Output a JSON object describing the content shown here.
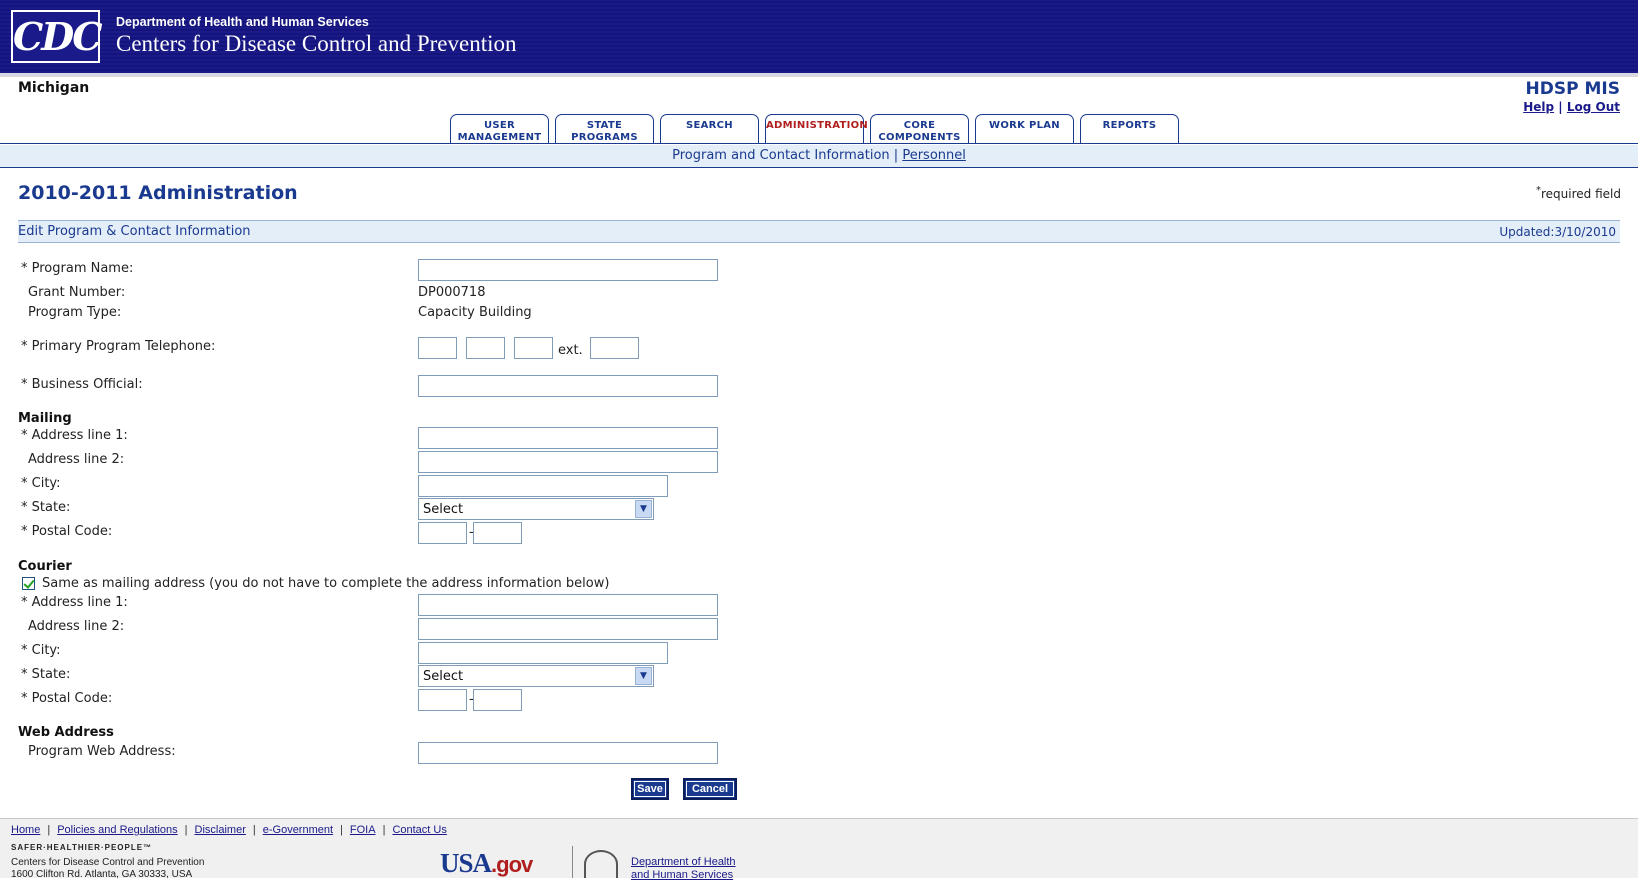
{
  "header": {
    "logo_text": "CDC",
    "department": "Department of Health and Human Services",
    "agency": "Centers for Disease Control and Prevention"
  },
  "top": {
    "state": "Michigan",
    "app_name": "HDSP MIS",
    "help": "Help",
    "separator": "|",
    "logout": "Log Out"
  },
  "tabs": [
    {
      "line1": "USER",
      "line2": "MANAGEMENT",
      "active": false
    },
    {
      "line1": "STATE",
      "line2": "PROGRAMS",
      "active": false
    },
    {
      "line1": "SEARCH",
      "line2": "",
      "active": false
    },
    {
      "line1": "ADMINISTRATION",
      "line2": "",
      "active": true
    },
    {
      "line1": "CORE",
      "line2": "COMPONENTS",
      "active": false
    },
    {
      "line1": "WORK PLAN",
      "line2": "",
      "active": false
    },
    {
      "line1": "REPORTS",
      "line2": "",
      "active": false
    }
  ],
  "subnav": {
    "current": "Program and Contact Information",
    "separator": "|",
    "link": "Personnel"
  },
  "page": {
    "title": "2010-2011 Administration",
    "required_mark": "*",
    "required_text": "required field",
    "section_title": "Edit Program & Contact Information",
    "updated": "Updated:3/10/2010"
  },
  "form": {
    "program_name_label": "* Program Name:",
    "grant_number_label": "Grant Number:",
    "grant_number_value": "DP000718",
    "program_type_label": "Program Type:",
    "program_type_value": "Capacity Building",
    "telephone_label": "* Primary Program Telephone:",
    "ext_label": "ext.",
    "business_official_label": "* Business Official:",
    "mailing_heading": "Mailing",
    "address1_label": "* Address line 1:",
    "address2_label": "Address line 2:",
    "city_label": "* City:",
    "state_label": "* State:",
    "state_value": "Select",
    "postal_label": "* Postal Code:",
    "postal_dash": "-",
    "courier_heading": "Courier",
    "same_as_mailing": "Same as mailing address (you do not have to complete the address information below)",
    "web_heading": "Web Address",
    "web_label": "Program Web Address:"
  },
  "buttons": {
    "save": "Save",
    "cancel": "Cancel"
  },
  "footer": {
    "links": [
      "Home",
      "Policies and Regulations",
      "Disclaimer",
      "e-Government",
      "FOIA",
      "Contact Us"
    ],
    "sep": "|",
    "slogan": "SAFER·HEALTHIER·PEOPLE™",
    "org_line1": "Centers for Disease Control and Prevention",
    "org_line2": "1600 Clifton Rd. Atlanta, GA 30333, USA",
    "usagov_main": "USA",
    "usagov_suffix": ".gov",
    "hhs_line1": "Department of Health",
    "hhs_line2": "and Human Services"
  },
  "colors": {
    "banner": "#1a1a8a",
    "accent": "#1a3a8f",
    "active_tab": "#b01e1e",
    "subnav_bg": "#e4eef8"
  }
}
